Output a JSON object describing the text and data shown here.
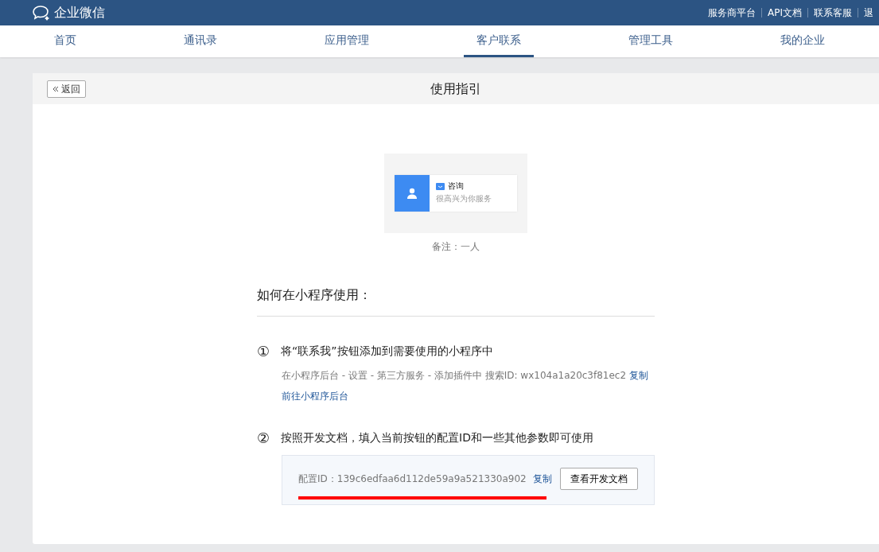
{
  "brand": {
    "name": "企业微信"
  },
  "top_links": [
    "服务商平台",
    "API文档",
    "联系客服",
    "退"
  ],
  "tabs": [
    {
      "label": "首页",
      "selected": false
    },
    {
      "label": "通讯录",
      "selected": false
    },
    {
      "label": "应用管理",
      "selected": false
    },
    {
      "label": "客户联系",
      "selected": true
    },
    {
      "label": "管理工具",
      "selected": false
    },
    {
      "label": "我的企业",
      "selected": false
    }
  ],
  "panel": {
    "back_button": "返回",
    "title": "使用指引"
  },
  "preview": {
    "button_title": "咨询",
    "button_subtitle": "很高兴为你服务",
    "note": "备注：一人"
  },
  "section_title": "如何在小程序使用：",
  "steps": [
    {
      "number": "①",
      "title": "将“联系我”按钮添加到需要使用的小程序中",
      "desc": "在小程序后台 - 设置 - 第三方服务 - 添加插件中 搜索ID: wx104a1a20c3f81ec2",
      "copy_link": "复制",
      "link": "前往小程序后台"
    },
    {
      "number": "②",
      "title": "按照开发文档，填入当前按钮的配置ID和一些其他参数即可使用",
      "config_label": "配置ID：",
      "config_id": "139c6edfaa6d112de59a9a521330a902",
      "copy_link": "复制",
      "doc_button": "查看开发文档"
    }
  ]
}
